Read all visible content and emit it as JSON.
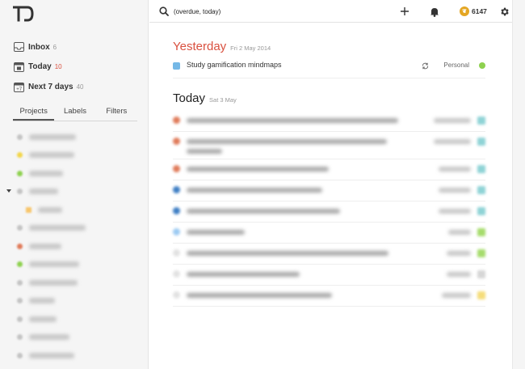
{
  "sidebar": {
    "nav": [
      {
        "label": "Inbox",
        "count": "6",
        "icon": "inbox-icon",
        "count_color": "#999999"
      },
      {
        "label": "Today",
        "count": "10",
        "icon": "today-icon",
        "count_color": "#d9503f"
      },
      {
        "label": "Next 7 days",
        "count": "40",
        "icon": "calendar-icon",
        "count_color": "#999999"
      }
    ],
    "tabs": [
      "Projects",
      "Labels",
      "Filters"
    ],
    "projects": [
      {
        "color": "#c4c4c4"
      },
      {
        "color": "#f2d64b"
      },
      {
        "color": "#8ed14f"
      },
      {
        "color": "#c4c4c4",
        "expanded": true
      },
      {
        "color": "#f7c56b",
        "child": true
      },
      {
        "color": "#c4c4c4"
      },
      {
        "color": "#e07b5a"
      },
      {
        "color": "#8ed14f"
      },
      {
        "color": "#c4c4c4"
      },
      {
        "color": "#c4c4c4"
      },
      {
        "color": "#c4c4c4"
      },
      {
        "color": "#c4c4c4"
      },
      {
        "color": "#c4c4c4"
      }
    ]
  },
  "topbar": {
    "search_value": "(overdue, today)",
    "karma_value": "6147",
    "icons": [
      "search-icon",
      "add-icon",
      "bell-icon",
      "karma-icon",
      "gear-icon"
    ]
  },
  "main": {
    "overdue": {
      "title": "Yesterday",
      "date": "Fri 2 May 2014",
      "tasks": [
        {
          "text": "Study gamification mindmaps",
          "project": "Personal",
          "project_color": "#8ed14f",
          "check_color": "#75b8e6"
        }
      ]
    },
    "today": {
      "title": "Today",
      "date": "Sat 3 May",
      "tasks": [
        {
          "check_color": "#e07b5a",
          "tag_color": "#8fd3d6"
        },
        {
          "check_color": "#e07b5a",
          "tag_color": "#8fd3d6",
          "two_lines": true
        },
        {
          "check_color": "#e07b5a",
          "tag_color": "#8fd3d6"
        },
        {
          "check_color": "#3e7ec4",
          "tag_color": "#8fd3d6"
        },
        {
          "check_color": "#3e7ec4",
          "tag_color": "#8fd3d6"
        },
        {
          "check_color": "#9ccaf2",
          "tag_color": "#a6dc6c"
        },
        {
          "check_color": "#e2e2e2",
          "tag_color": "#a6dc6c"
        },
        {
          "check_color": "#e2e2e2",
          "tag_color": "#d6d6d6"
        },
        {
          "check_color": "#e2e2e2",
          "tag_color": "#f5dd7a"
        }
      ]
    }
  }
}
